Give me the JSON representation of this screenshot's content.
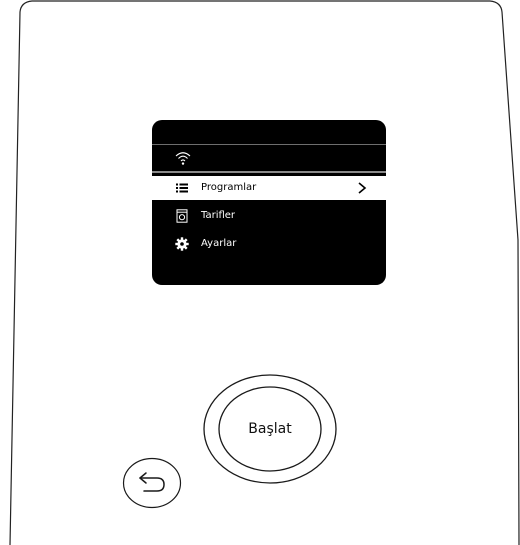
{
  "panel": {
    "menu": [
      {
        "label": "Programlar",
        "icon": "list-icon",
        "selected": true,
        "has_chevron": true
      },
      {
        "label": "Tarifler",
        "icon": "recipe-book-icon",
        "selected": false,
        "has_chevron": false
      },
      {
        "label": "Ayarlar",
        "icon": "gear-icon",
        "selected": false,
        "has_chevron": false
      }
    ],
    "status": {
      "wifi_icon": "wifi-icon"
    }
  },
  "controls": {
    "start_label": "Başlat",
    "back_icon": "back-arrow-icon"
  },
  "colors": {
    "screen": "#000000",
    "selected_row": "#ffffff",
    "outline": "#222222"
  }
}
